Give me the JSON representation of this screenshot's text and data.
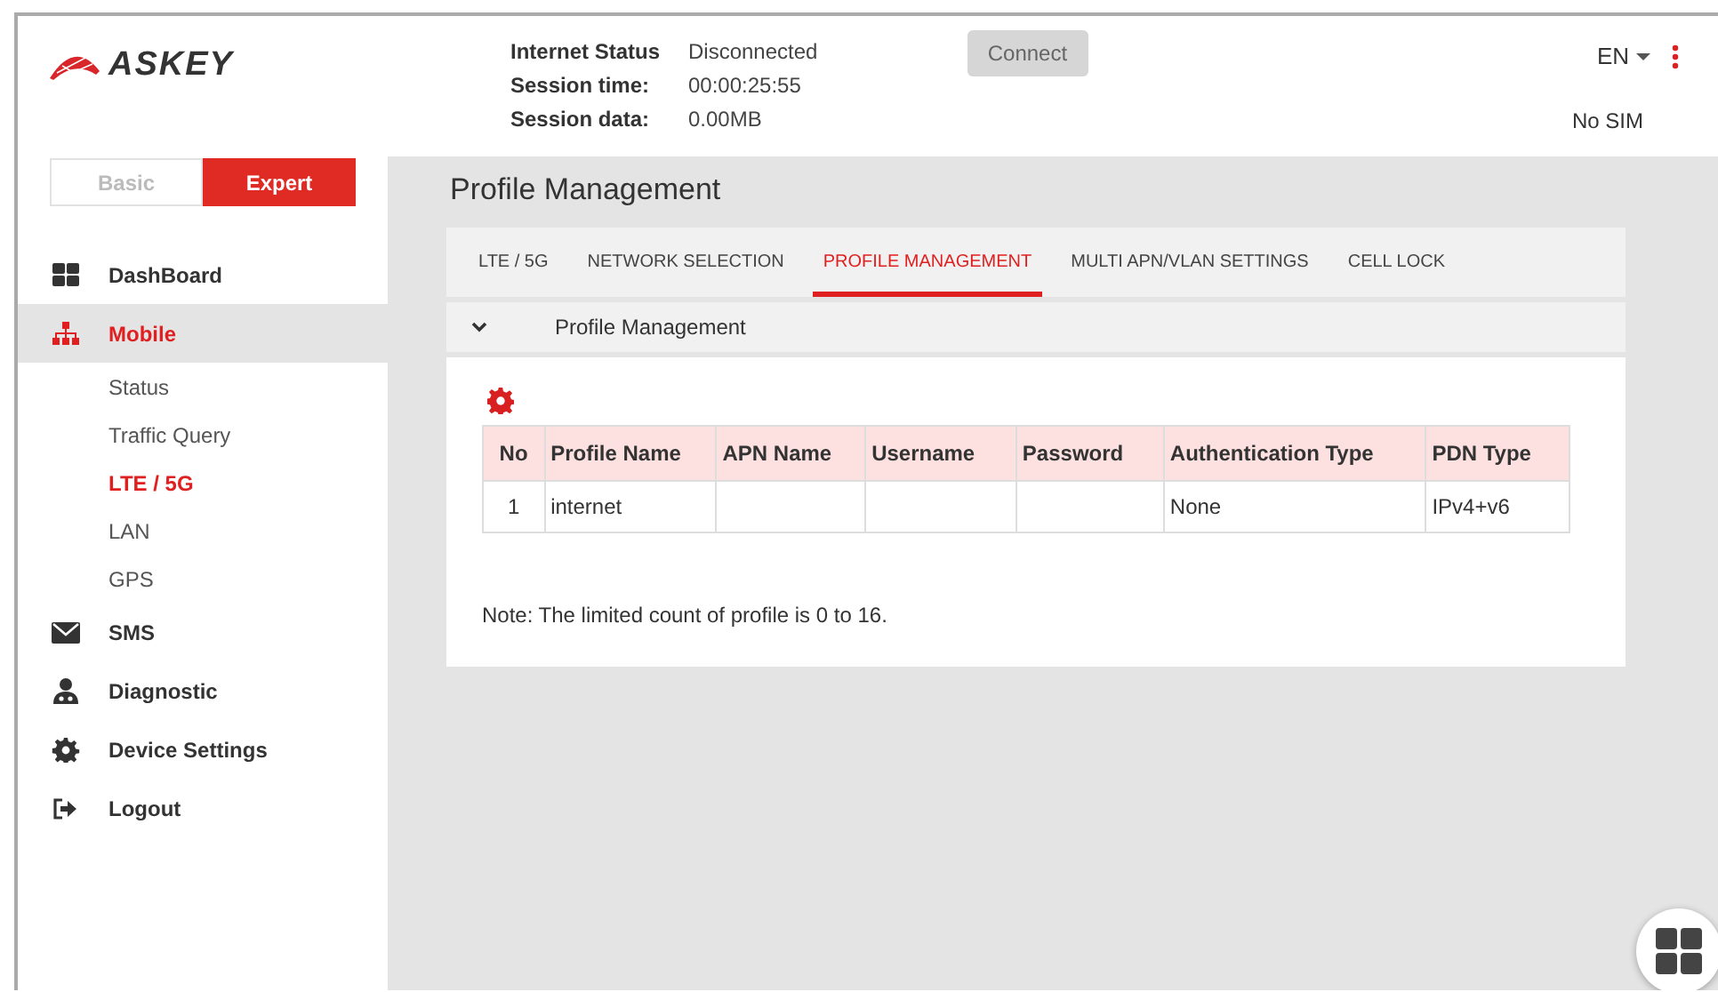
{
  "header": {
    "logo": "ASKEY",
    "status": [
      {
        "label": "Internet Status",
        "value": "Disconnected"
      },
      {
        "label": "Session time:",
        "value": "00:00:25:55"
      },
      {
        "label": "Session data:",
        "value": "0.00MB"
      }
    ],
    "connect_button": {
      "label": "Connect",
      "disabled": true
    },
    "language": "EN",
    "sim_status": "No SIM"
  },
  "mode_switch": [
    {
      "label": "Basic",
      "selected": false
    },
    {
      "label": "Expert",
      "selected": true
    }
  ],
  "sidebar": {
    "items": [
      {
        "label": "DashBoard",
        "selected": false
      },
      {
        "label": "Mobile",
        "selected": true,
        "children": [
          {
            "label": "Status",
            "selected": false
          },
          {
            "label": "Traffic Query",
            "selected": false
          },
          {
            "label": "LTE / 5G",
            "selected": true
          },
          {
            "label": "LAN",
            "selected": false
          },
          {
            "label": "GPS",
            "selected": false
          }
        ]
      },
      {
        "label": "SMS",
        "selected": false
      },
      {
        "label": "Diagnostic",
        "selected": false
      },
      {
        "label": "Device Settings",
        "selected": false
      },
      {
        "label": "Logout",
        "selected": false
      }
    ]
  },
  "page_title": "Profile Management",
  "tabs": [
    {
      "label": "LTE / 5G",
      "selected": false
    },
    {
      "label": "NETWORK SELECTION",
      "selected": false
    },
    {
      "label": "PROFILE MANAGEMENT",
      "selected": true
    },
    {
      "label": "MULTI APN/VLAN SETTINGS",
      "selected": false
    },
    {
      "label": "CELL LOCK",
      "selected": false
    }
  ],
  "section": {
    "title": "Profile Management",
    "expanded": true
  },
  "table": {
    "columns": [
      "No",
      "Profile Name",
      "APN Name",
      "Username",
      "Password",
      "Authentication Type",
      "PDN Type"
    ],
    "rows": [
      [
        "1",
        "internet",
        null,
        null,
        null,
        "None",
        "IPv4+v6"
      ]
    ]
  },
  "note": "Note: The limited count of profile is 0 to 16."
}
